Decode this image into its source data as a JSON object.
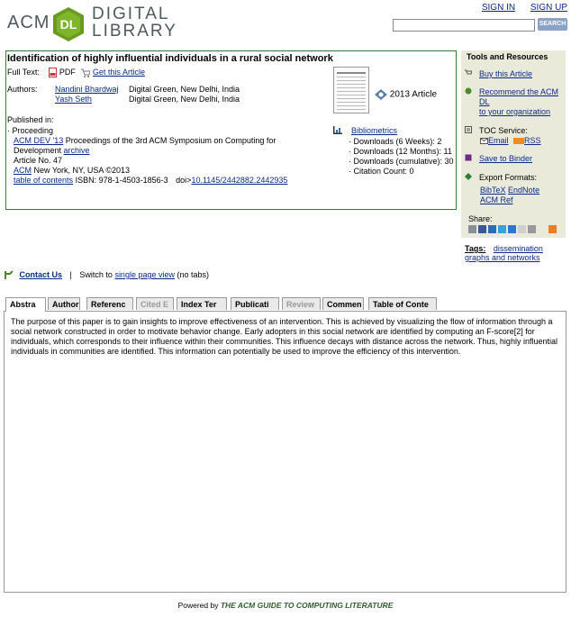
{
  "header": {
    "logo": {
      "acm": "ACM",
      "dl": "DL",
      "digital": "DIGITAL",
      "library": "LIBRARY"
    },
    "sign_in": "SIGN IN",
    "sign_up": "SIGN UP",
    "search": {
      "value": "",
      "button": "SEARCH"
    }
  },
  "article": {
    "title": "Identification of highly influential individuals in a rural social network",
    "full_text_label": "Full Text:",
    "pdf_label": "PDF",
    "get_article": "Get this Article",
    "authors_label": "Authors:",
    "authors": [
      {
        "name": "Nandini Bhardwaj",
        "affiliation": "Digital Green, New Delhi, India"
      },
      {
        "name": "Yash Seth",
        "affiliation": "Digital Green, New Delhi, India"
      }
    ],
    "published_in": "Published in:",
    "proceeding_label": "· Proceeding",
    "proceeding_link": "ACM DEV '13",
    "proceeding_desc": "Proceedings of the 3rd ACM Symposium on Computing for",
    "proceeding_desc2": "Development",
    "archive": "archive",
    "article_no": "Article No. 47",
    "publisher_link": "ACM",
    "publisher_rest": "New York, NY, USA ©2013",
    "toc": "table of contents",
    "isbn": "ISBN: 978-1-4503-1856-3",
    "doi_label": "doi>",
    "doi": "10.1145/2442882.2442935",
    "year_badge": "2013 Article",
    "bibliometrics": "Bibliometrics",
    "downloads_6w": "· Downloads (6 Weeks): 2",
    "downloads_12m": "· Downloads (12 Months): 11",
    "downloads_cum": "· Downloads (cumulative): 30",
    "citation_count": "· Citation Count: 0"
  },
  "sidebar": {
    "title": "Tools and Resources",
    "buy": "Buy this Article",
    "recommend_1": "Recommend the ACM",
    "recommend_2": "DL",
    "recommend_3": "to your organization",
    "toc_service": "TOC Service:",
    "email": "Email",
    "rss": "RSS",
    "binder": "Save to Binder",
    "export": "Export Formats:",
    "bibtex": "BibTeX",
    "endnote": "EndNote",
    "acmref": "ACM Ref",
    "share": "Share:",
    "tags_label": "Tags:",
    "tag1": "dissemination",
    "tag2": "graphs and networks"
  },
  "contact": {
    "link": "Contact Us",
    "switch_pre": "Switch to",
    "switch_link": "single page view",
    "switch_post": "(no tabs)",
    "separator": "|"
  },
  "tabs": [
    "Abstra",
    "Author",
    "Referenc",
    "Cited E",
    "Index Ter",
    "Publicati",
    "Review",
    "Commen",
    "Table of Conte"
  ],
  "abstract": "The purpose of this paper is to gain insights to improve effectiveness of an intervention. This is achieved by visualizing the flow of information through a social network constructed in order to motivate behavior change. Early adopters in this social network are identified by computing an F-score[2] for individuals, which corresponds to their influence within their communities. This influence decays with distance across the network. Thus, highly influential individuals in communities are identified. This information can potentially be used to improve the efficiency of this intervention.",
  "footer": {
    "powered": "Powered by",
    "guide": "THE ACM GUIDE TO COMPUTING LITERATURE"
  },
  "colors": {
    "accent_green": "#2e7d32",
    "link_blue": "#0a2a8a",
    "sidebar_bg": "#eaeadb"
  }
}
